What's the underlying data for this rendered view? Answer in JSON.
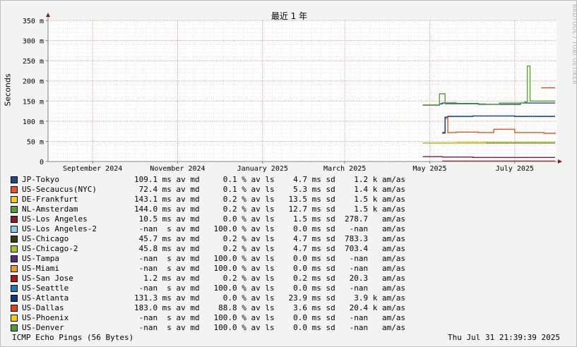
{
  "chart_data": {
    "type": "line",
    "title": "最近 1 年",
    "ylabel": "Seconds",
    "y_ticks": [
      "0",
      "50 m",
      "100 m",
      "150 m",
      "200 m",
      "250 m",
      "300 m",
      "350 m"
    ],
    "y_tick_values": [
      0,
      50,
      100,
      150,
      200,
      250,
      300,
      350
    ],
    "ylim": [
      0,
      350
    ],
    "x_ticks": [
      "September 2024",
      "November 2024",
      "January 2025",
      "March 2025",
      "May 2025",
      "July 2025"
    ],
    "x_tick_dates": [
      "2024-09-01",
      "2024-11-01",
      "2025-01-01",
      "2025-03-01",
      "2025-05-01",
      "2025-07-01"
    ],
    "xlim": [
      "2024-07-31",
      "2025-07-31"
    ],
    "grid": true,
    "series": [
      {
        "name": "JP-Tokyo",
        "color": "#1a4a8a",
        "x": [
          "2025-04-26",
          "2025-05-08",
          "2025-05-10",
          "2025-05-20",
          "2025-06-05",
          "2025-06-20",
          "2025-07-05",
          "2025-07-30"
        ],
        "y": [
          140,
          143,
          145,
          144,
          142,
          142,
          145,
          145
        ]
      },
      {
        "name": "US-Secaucus(NYC)",
        "color": "#e8531f",
        "x": [
          "2025-05-10",
          "2025-05-12",
          "2025-05-14",
          "2025-05-20",
          "2025-06-05",
          "2025-06-15",
          "2025-06-16",
          "2025-07-01",
          "2025-07-10",
          "2025-07-22",
          "2025-07-30"
        ],
        "y": [
          70,
          107,
          72,
          73,
          72,
          72,
          80,
          72,
          72,
          70,
          68
        ]
      },
      {
        "name": "DE-Frankfurt",
        "color": "#d8d000",
        "x": [
          "2025-04-26",
          "2025-05-08",
          "2025-05-20",
          "2025-06-10",
          "2025-07-10",
          "2025-07-30"
        ],
        "y": [
          46,
          46,
          47,
          47,
          47,
          47
        ]
      },
      {
        "name": "NL-Amsterdam",
        "color": "#5aa02c",
        "x": [
          "2025-04-26",
          "2025-05-06",
          "2025-05-08",
          "2025-05-12",
          "2025-06-10",
          "2025-06-20",
          "2025-07-08",
          "2025-07-10",
          "2025-07-12",
          "2025-07-30"
        ],
        "y": [
          140,
          140,
          168,
          143,
          142,
          145,
          148,
          237,
          150,
          150
        ]
      },
      {
        "name": "US-Los Angeles",
        "color": "#8a1a30",
        "x": [
          "2025-04-26",
          "2025-05-10",
          "2025-06-01",
          "2025-06-20",
          "2025-07-10",
          "2025-07-30"
        ],
        "y": [
          12,
          11,
          10,
          10,
          10,
          10
        ]
      },
      {
        "name": "US-Los Angeles-2",
        "color": "#87cdf0",
        "x": [],
        "y": []
      },
      {
        "name": "US-Chicago",
        "color": "#3d3a10",
        "x": [
          "2025-04-26",
          "2025-05-10",
          "2025-06-10",
          "2025-07-30"
        ],
        "y": [
          46,
          46,
          46,
          46
        ]
      },
      {
        "name": "US-Chicago-2",
        "color": "#a8c820",
        "x": [
          "2025-04-26",
          "2025-05-10",
          "2025-06-10",
          "2025-07-30"
        ],
        "y": [
          46,
          46,
          47,
          47
        ]
      },
      {
        "name": "US-Tampa",
        "color": "#5c2a7a",
        "x": [],
        "y": []
      },
      {
        "name": "US-Miami",
        "color": "#f09a20",
        "x": [],
        "y": []
      },
      {
        "name": "US-San Jose",
        "color": "#b01515",
        "x": [
          "2025-05-10",
          "2025-07-30"
        ],
        "y": [
          1.2,
          1.2
        ]
      },
      {
        "name": "US-Seattle",
        "color": "#1a7ac0",
        "x": [],
        "y": []
      },
      {
        "name": "US-Atlanta",
        "color": "#0a3a80",
        "x": [
          "2025-05-10",
          "2025-05-12",
          "2025-05-14",
          "2025-06-01",
          "2025-07-01",
          "2025-07-30"
        ],
        "y": [
          72,
          110,
          112,
          113,
          112,
          112
        ]
      },
      {
        "name": "US-Dallas",
        "color": "#e84010",
        "x": [
          "2025-07-20",
          "2025-07-30"
        ],
        "y": [
          183,
          183
        ]
      },
      {
        "name": "US-Phoenix",
        "color": "#f0d000",
        "x": [],
        "y": []
      },
      {
        "name": "US-Denver",
        "color": "#50a030",
        "x": [],
        "y": []
      }
    ]
  },
  "legend": [
    {
      "label": "JP-Tokyo",
      "color": "#1a4a8a",
      "stats": "        109.1 ms av md     0.1 % av ls    4.7 ms sd    1.2 k am/as"
    },
    {
      "label": "US-Secaucus(NYC)",
      "color": "#e8531f",
      "stats": "         72.4 ms av md     0.1 % av ls    5.3 ms sd    1.4 k am/as"
    },
    {
      "label": "DE-Frankfurt",
      "color": "#f0d000",
      "stats": "        143.1 ms av md     0.2 % av ls   13.5 ms sd    1.5 k am/as"
    },
    {
      "label": "NL-Amsterdam",
      "color": "#5aa02c",
      "stats": "        144.0 ms av md     0.2 % av ls   12.7 ms sd    1.5 k am/as"
    },
    {
      "label": "US-Los Angeles",
      "color": "#8a1a30",
      "stats": "         10.5 ms av md     0.0 % av ls    1.5 ms sd  278.7   am/as"
    },
    {
      "label": "US-Los Angeles-2",
      "color": "#87cdf0",
      "stats": "         -nan  s av md   100.0 % av ls    0.0 ms sd   -nan   am/as"
    },
    {
      "label": "US-Chicago",
      "color": "#3d3a10",
      "stats": "         45.7 ms av md     0.2 % av ls    4.7 ms sd  783.3   am/as"
    },
    {
      "label": "US-Chicago-2",
      "color": "#a8c820",
      "stats": "         45.8 ms av md     0.2 % av ls    4.7 ms sd  703.4   am/as"
    },
    {
      "label": "US-Tampa",
      "color": "#5c2a7a",
      "stats": "         -nan  s av md   100.0 % av ls    0.0 ms sd   -nan   am/as"
    },
    {
      "label": "US-Miami",
      "color": "#f09a20",
      "stats": "         -nan  s av md   100.0 % av ls    0.0 ms sd   -nan   am/as"
    },
    {
      "label": "US-San Jose",
      "color": "#b01515",
      "stats": "          1.2 ms av md     0.2 % av ls    0.2 ms sd   20.3   am/as"
    },
    {
      "label": "US-Seattle",
      "color": "#1a7ac0",
      "stats": "         -nan  s av md   100.0 % av ls    0.0 ms sd   -nan   am/as"
    },
    {
      "label": "US-Atlanta",
      "color": "#0a3a80",
      "stats": "        131.3 ms av md     0.0 % av ls   23.9 ms sd    3.9 k am/as"
    },
    {
      "label": "US-Dallas",
      "color": "#e84010",
      "stats": "        183.0 ms av md    88.8 % av ls    3.6 ms sd   20.4 k am/as"
    },
    {
      "label": "US-Phoenix",
      "color": "#f0d000",
      "stats": "         -nan  s av md   100.0 % av ls    0.0 ms sd   -nan   am/as"
    },
    {
      "label": "US-Denver",
      "color": "#50a030",
      "stats": "         -nan  s av md   100.0 % av ls    0.0 ms sd   -nan   am/as"
    }
  ],
  "footer": {
    "left": "ICMP Echo Pings (56 Bytes)",
    "right": "Thu Jul 31 21:39:39 2025"
  },
  "watermark": "RRDTOOL / TOBI OETIKER"
}
